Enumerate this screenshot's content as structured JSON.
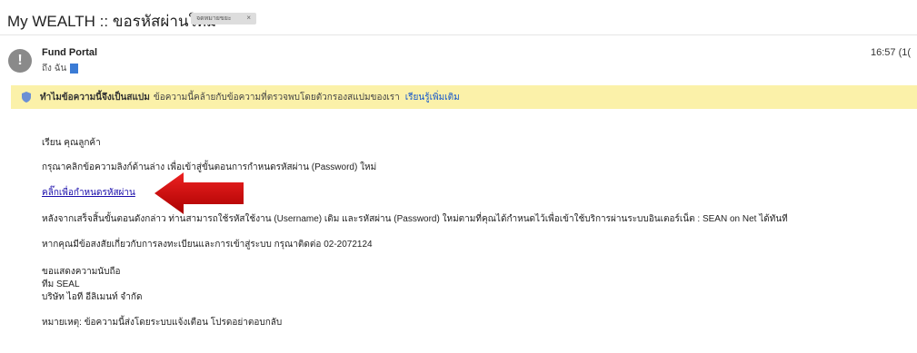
{
  "header": {
    "subject": "My WEALTH :: ขอรหัสผ่านใหม่",
    "label_chip": "จดหมายขยะ",
    "label_close": "×"
  },
  "message": {
    "sender": "Fund Portal",
    "to_prefix": "ถึง ฉัน",
    "time": "16:57 (1(",
    "avatar_icon": "!"
  },
  "spam_banner": {
    "title": "ทำไมข้อความนี้จึงเป็นสแปม",
    "text": "ข้อความนี้คล้ายกับข้อความที่ตรวจพบโดยตัวกรองสแปมของเรา",
    "learn_more": "เรียนรู้เพิ่มเติม",
    "icon": "shield-icon"
  },
  "body": {
    "greeting": "เรียน คุณลูกค้า",
    "instruction": "กรุณาคลิกข้อความลิงก์ด้านล่าง เพื่อเข้าสู่ขั้นตอนการกำหนดรหัสผ่าน (Password) ใหม่",
    "link_text": "คลิ๊กเพื่อกำหนดรหัสผ่าน",
    "after_steps": "หลังจากเสร็จสิ้นขั้นตอนดังกล่าว ท่านสามารถใช้รหัสใช้งาน (Username) เดิม และรหัสผ่าน (Password) ใหม่ตามที่คุณได้กำหนดไว้เพื่อเข้าใช้บริการผ่านระบบอินเตอร์เน็ต : SEAN on Net ได้ทันที",
    "contact": "หากคุณมีข้อสงสัยเกี่ยวกับการลงทะเบียนและการเข้าสู่ระบบ กรุณาติดต่อ 02-2072124",
    "thanks": "ขอแสดงความนับถือ",
    "team": "ทีม SEAL",
    "company": "บริษัท ไอที อีลิเมนท์ จำกัด",
    "note": "หมายเหตุ: ข้อความนี้ส่งโดยระบบแจ้งเตือน โปรดอย่าตอบกลับ"
  },
  "colors": {
    "banner_bg": "#fbf1a9",
    "link": "#1a0dab",
    "arrow": "#cc0000"
  }
}
